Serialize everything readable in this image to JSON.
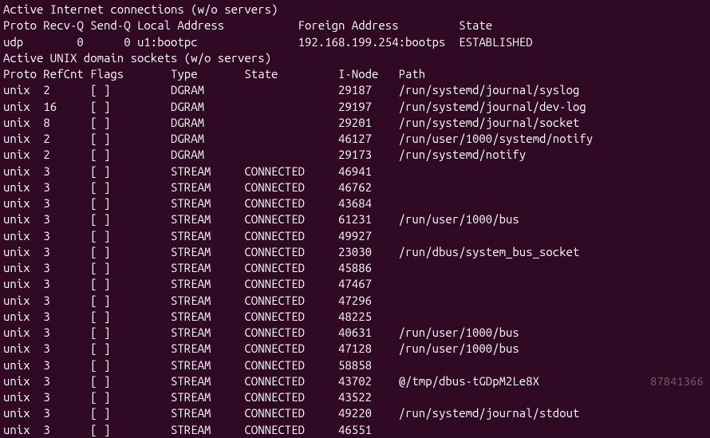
{
  "header_inet": "Active Internet connections (w/o servers)",
  "inet_cols": "Proto Recv-Q Send-Q Local Address           Foreign Address         State",
  "inet_row": "udp        0      0 u1:bootpc               192.168.199.254:bootps  ESTABLISHED",
  "header_unix": "Active UNIX domain sockets (w/o servers)",
  "unix_cols": "Proto RefCnt Flags       Type       State         I-Node   Path",
  "unix_rows": [
    "unix  2      [ ]         DGRAM                    29187    /run/systemd/journal/syslog",
    "unix  16     [ ]         DGRAM                    29197    /run/systemd/journal/dev-log",
    "unix  8      [ ]         DGRAM                    29201    /run/systemd/journal/socket",
    "unix  2      [ ]         DGRAM                    46127    /run/user/1000/systemd/notify",
    "unix  2      [ ]         DGRAM                    29173    /run/systemd/notify",
    "unix  3      [ ]         STREAM     CONNECTED     46941    ",
    "unix  3      [ ]         STREAM     CONNECTED     46762    ",
    "unix  3      [ ]         STREAM     CONNECTED     43684    ",
    "unix  3      [ ]         STREAM     CONNECTED     61231    /run/user/1000/bus",
    "unix  3      [ ]         STREAM     CONNECTED     49927    ",
    "unix  3      [ ]         STREAM     CONNECTED     23030    /run/dbus/system_bus_socket",
    "unix  3      [ ]         STREAM     CONNECTED     45886    ",
    "unix  3      [ ]         STREAM     CONNECTED     47467    ",
    "unix  3      [ ]         STREAM     CONNECTED     47296    ",
    "unix  3      [ ]         STREAM     CONNECTED     48225    ",
    "unix  3      [ ]         STREAM     CONNECTED     40631    /run/user/1000/bus",
    "unix  3      [ ]         STREAM     CONNECTED     47128    /run/user/1000/bus",
    "unix  3      [ ]         STREAM     CONNECTED     58858    ",
    "unix  3      [ ]         STREAM     CONNECTED     43702    @/tmp/dbus-tGDpM2Le8X",
    "unix  3      [ ]         STREAM     CONNECTED     43522    ",
    "unix  3      [ ]         STREAM     CONNECTED     49220    /run/systemd/journal/stdout",
    "unix  3      [ ]         STREAM     CONNECTED     46551    "
  ],
  "watermark": "87841366"
}
